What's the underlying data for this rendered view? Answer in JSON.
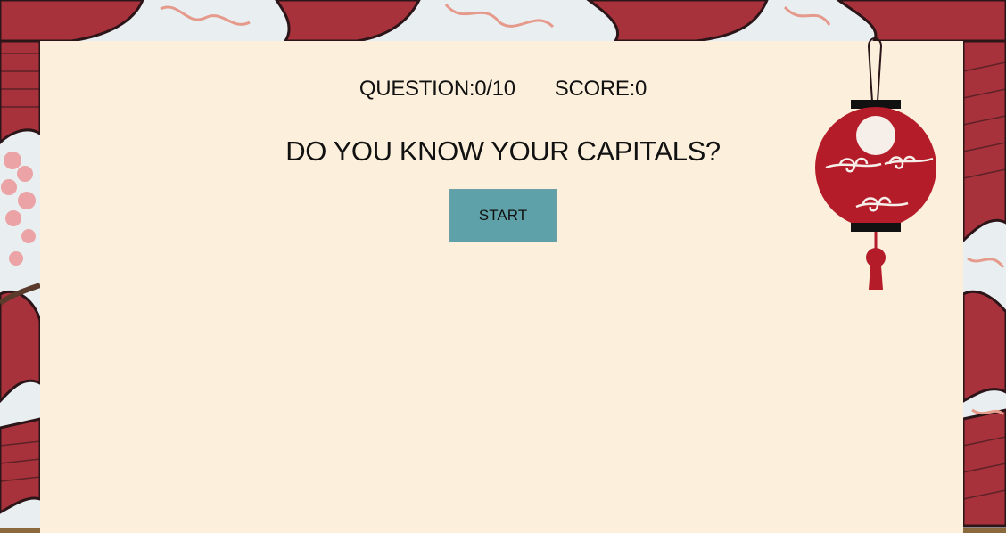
{
  "game": {
    "question_label": "QUESTION:",
    "question_current": "0",
    "question_separator": "/",
    "question_total": "10",
    "score_label": "SCORE:",
    "score_value": "0",
    "title": "DO YOU KNOW YOUR CAPITALS?",
    "start_label": "START"
  },
  "theme": {
    "card_background": "#fcf0dc",
    "button_color": "#5fa1a8",
    "lantern_red": "#b51c2a",
    "wave_red": "#a8323c"
  }
}
